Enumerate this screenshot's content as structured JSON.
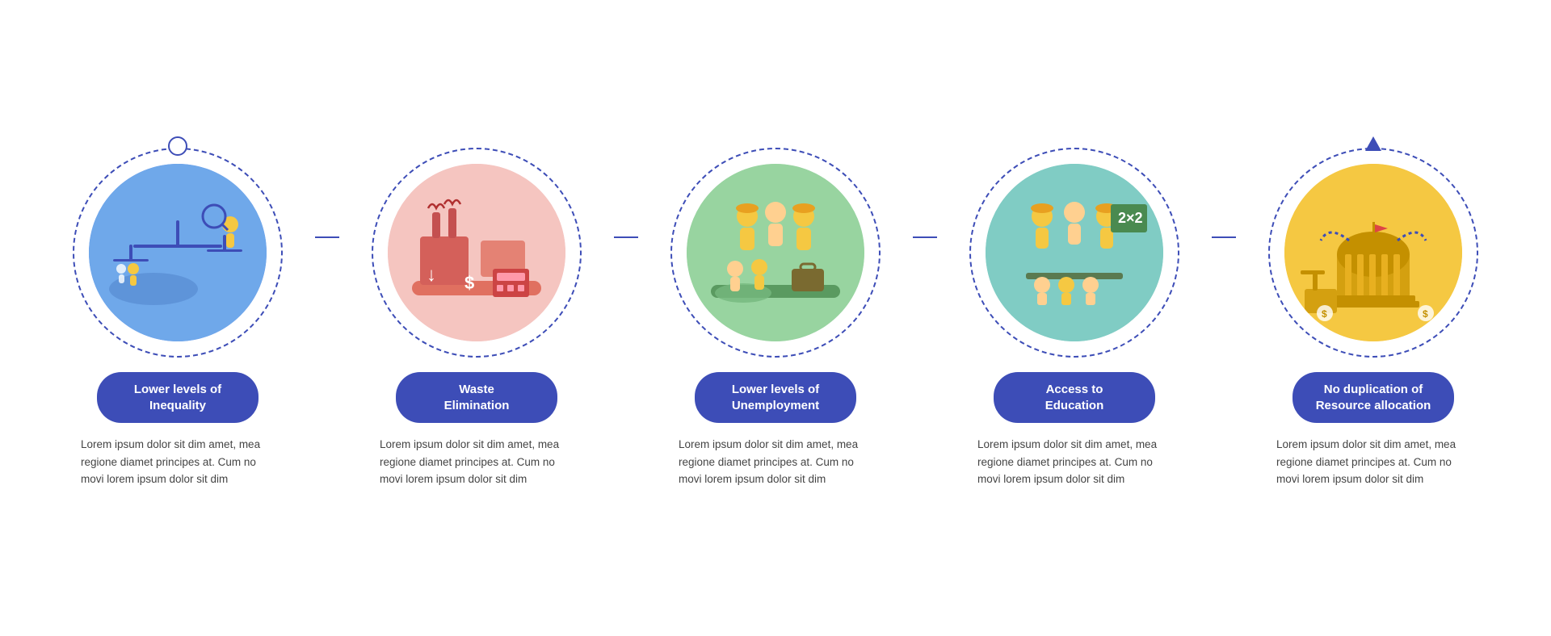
{
  "cards": [
    {
      "id": "inequality",
      "badge_line1": "Lower levels of",
      "badge_line2": "Inequality",
      "description": "Lorem ipsum dolor sit dim amet, mea regione diamet principes at. Cum no movi lorem ipsum dolor sit dim",
      "bg_color": "bg-blue",
      "connector_top": "circle",
      "icon_type": "inequality"
    },
    {
      "id": "waste",
      "badge_line1": "Waste",
      "badge_line2": "Elimination",
      "description": "Lorem ipsum dolor sit dim amet, mea regione diamet principes at. Cum no movi lorem ipsum dolor sit dim",
      "bg_color": "bg-pink",
      "connector_top": "none",
      "icon_type": "waste"
    },
    {
      "id": "unemployment",
      "badge_line1": "Lower levels of",
      "badge_line2": "Unemployment",
      "description": "Lorem ipsum dolor sit dim amet, mea regione diamet principes at. Cum no movi lorem ipsum dolor sit dim",
      "bg_color": "bg-green",
      "connector_top": "none",
      "icon_type": "unemployment"
    },
    {
      "id": "education",
      "badge_line1": "Access to",
      "badge_line2": "Education",
      "description": "Lorem ipsum dolor sit dim amet, mea regione diamet principes at. Cum no movi lorem ipsum dolor sit dim",
      "bg_color": "bg-teal",
      "connector_top": "none",
      "icon_type": "education"
    },
    {
      "id": "resource",
      "badge_line1": "No duplication of",
      "badge_line2": "Resource allocation",
      "description": "Lorem ipsum dolor sit dim amet, mea regione diamet principes at. Cum no movi lorem ipsum dolor sit dim",
      "bg_color": "bg-yellow",
      "connector_top": "triangle",
      "icon_type": "resource"
    }
  ]
}
